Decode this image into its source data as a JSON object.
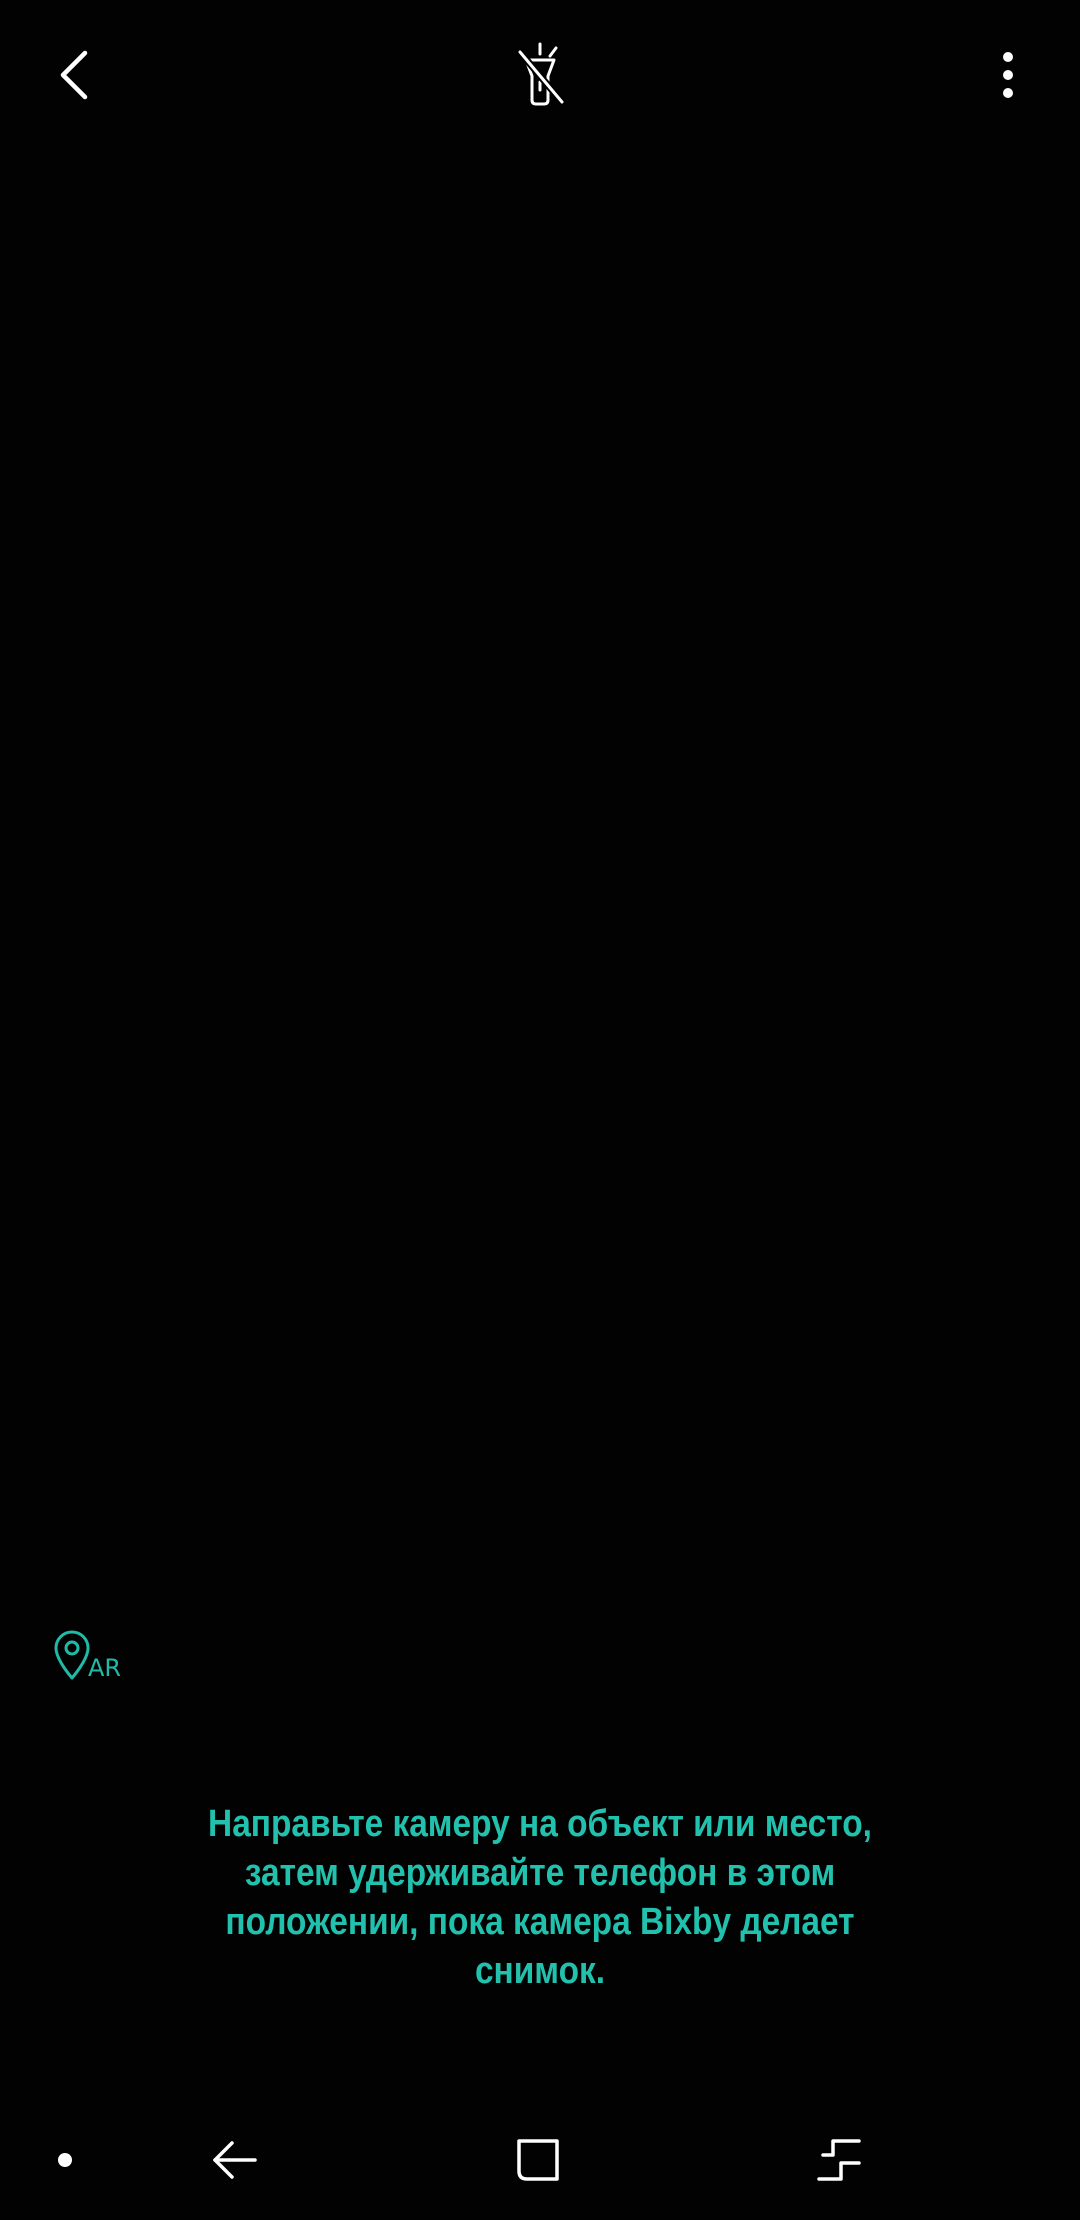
{
  "camera": {
    "hint_text": "Направьте камеру на объект или место, затем удерживайте телефон в этом положении, пока камера Bixby делает снимок."
  },
  "toolbar": {
    "back_icon": "chevron-left-icon",
    "flash_icon": "flashlight-off-icon",
    "more_icon": "more-vertical-icon"
  },
  "ar_button": {
    "icon": "location-pin-icon",
    "label": "AR"
  },
  "navbar": {
    "dot_icon": "dot-icon",
    "back_icon": "back-arrow-icon",
    "home_icon": "home-square-icon",
    "recents_icon": "recents-icon"
  },
  "colors": {
    "accent": "#22c1ae",
    "background": "#000000",
    "icon": "#ffffff"
  }
}
